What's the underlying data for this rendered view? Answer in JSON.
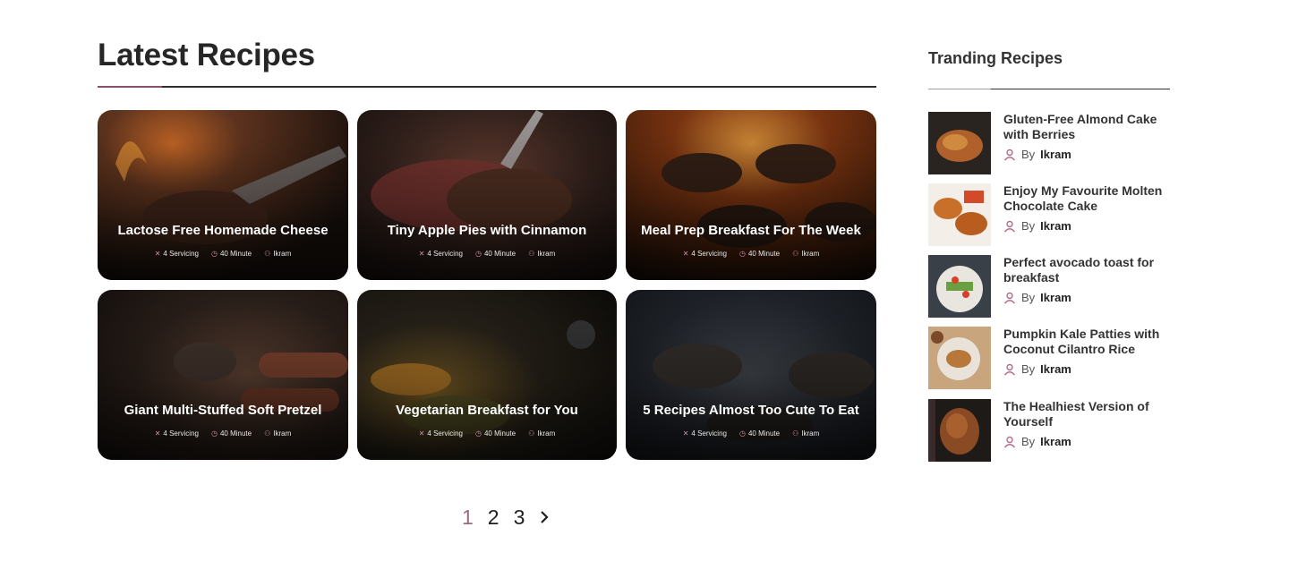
{
  "latest": {
    "heading": "Latest Recipes",
    "cards": [
      {
        "title": "Lactose Free Homemade Cheese",
        "servings": "4 Servicing",
        "time": "40 Minute",
        "author": "Ikram"
      },
      {
        "title": "Tiny Apple Pies with Cinnamon",
        "servings": "4 Servicing",
        "time": "40 Minute",
        "author": "Ikram"
      },
      {
        "title": "Meal Prep Breakfast For The Week",
        "servings": "4 Servicing",
        "time": "40 Minute",
        "author": "Ikram"
      },
      {
        "title": "Giant Multi-Stuffed Soft Pretzel",
        "servings": "4 Servicing",
        "time": "40 Minute",
        "author": "Ikram"
      },
      {
        "title": "Vegetarian Breakfast for You",
        "servings": "4 Servicing",
        "time": "40 Minute",
        "author": "Ikram"
      },
      {
        "title": "5 Recipes Almost Too Cute To Eat",
        "servings": "4 Servicing",
        "time": "40 Minute",
        "author": "Ikram"
      }
    ]
  },
  "pagination": {
    "pages": [
      "1",
      "2",
      "3"
    ],
    "active_page": "1",
    "next_icon": "chevron-right-icon"
  },
  "trending": {
    "heading": "Tranding Recipes",
    "by_label": "By",
    "items": [
      {
        "title": "Gluten-Free Almond Cake with Berries",
        "author": "Ikram"
      },
      {
        "title": "Enjoy My Favourite Molten Chocolate Cake",
        "author": "Ikram"
      },
      {
        "title": "Perfect avocado toast for breakfast",
        "author": "Ikram"
      },
      {
        "title": "Pumpkin Kale Patties with Coconut Cilantro Rice",
        "author": "Ikram"
      },
      {
        "title": "The Healhiest Version of Yourself",
        "author": "Ikram"
      }
    ]
  },
  "colors": {
    "accent": "#9a6a82",
    "heading": "#262626",
    "icon": "#c98fa9"
  }
}
